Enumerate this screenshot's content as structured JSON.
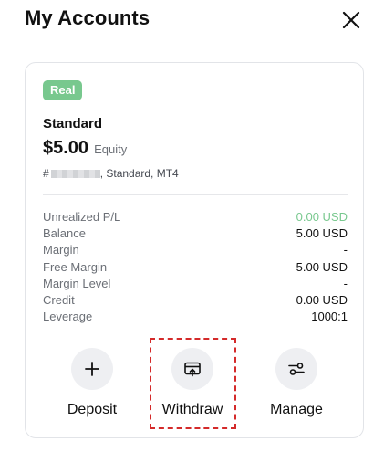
{
  "header": {
    "title": "My Accounts",
    "close_icon": "close-icon"
  },
  "account": {
    "badge": "Real",
    "name": "Standard",
    "balance": "$5.00",
    "balance_label": "Equity",
    "id_prefix": "#",
    "id_suffix": ", Standard, MT4"
  },
  "stats": [
    {
      "label": "Unrealized P/L",
      "value": "0.00 USD",
      "positive": true
    },
    {
      "label": "Balance",
      "value": "5.00 USD"
    },
    {
      "label": "Margin",
      "value": "-"
    },
    {
      "label": "Free Margin",
      "value": "5.00 USD"
    },
    {
      "label": "Margin Level",
      "value": "-"
    },
    {
      "label": "Credit",
      "value": "0.00 USD"
    },
    {
      "label": "Leverage",
      "value": "1000:1"
    }
  ],
  "actions": {
    "deposit": {
      "label": "Deposit",
      "icon": "plus-icon"
    },
    "withdraw": {
      "label": "Withdraw",
      "icon": "withdraw-card-icon"
    },
    "manage": {
      "label": "Manage",
      "icon": "sliders-icon"
    }
  },
  "colors": {
    "badge_green": "#78c88e",
    "positive_green": "#78c88e",
    "highlight_red": "#d42a2a",
    "circle_bg": "#eeeff2"
  }
}
